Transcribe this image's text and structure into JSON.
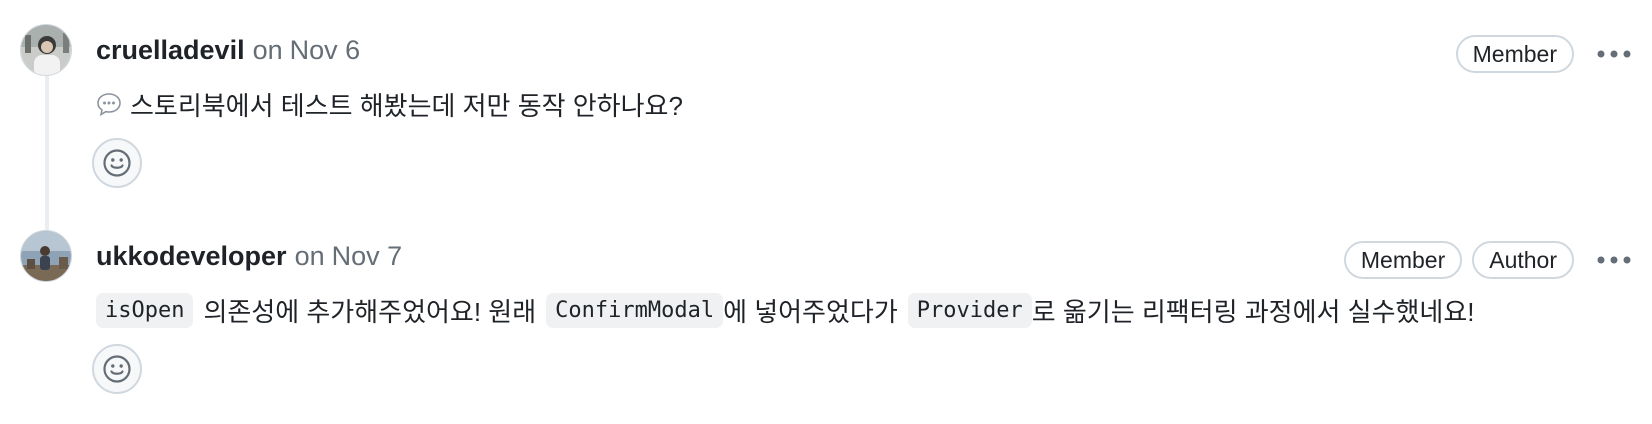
{
  "comments": [
    {
      "author": "cruelladevil",
      "on_label": "on",
      "date": "Nov 6",
      "labels": [
        "Member"
      ],
      "body": {
        "icon": "speech-bubble-icon",
        "text": "스토리북에서 테스트 해봤는데 저만 동작 안하나요?"
      }
    },
    {
      "author": "ukkodeveloper",
      "on_label": "on",
      "date": "Nov 7",
      "labels": [
        "Member",
        "Author"
      ],
      "body": {
        "code_1": "isOpen",
        "text_1": "의존성에 추가해주었어요! 원래",
        "code_2": "ConfirmModal",
        "text_2": "에 넣어주었다가",
        "code_3": "Provider",
        "text_3": "로 옮기는 리팩터링 과정에서 실수했네요!"
      }
    }
  ],
  "colors": {
    "text": "#1f2328",
    "muted": "#656d76",
    "border": "#d0d7de",
    "code_bg": "#eff1f3",
    "thread_line": "#eaeef2"
  }
}
